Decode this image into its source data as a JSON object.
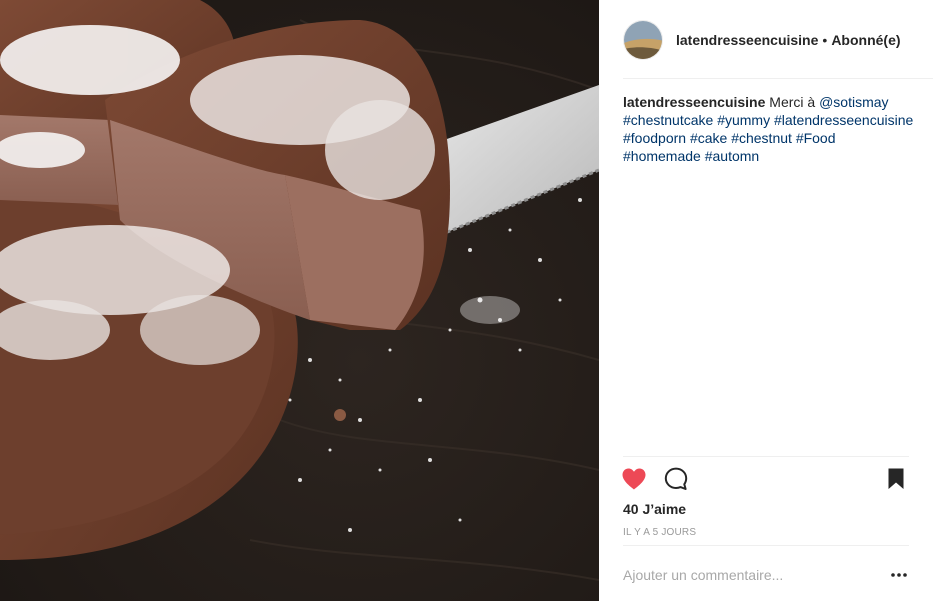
{
  "post": {
    "username": "latendresseencuisine",
    "separator": "•",
    "follow_label": "Abonné(e)",
    "caption": {
      "username": "latendresseencuisine",
      "text": "Merci à ",
      "mention": "@sotismay",
      "hashtags": [
        "#chestnutcake",
        "#yummy",
        "#latendresseencuisine",
        "#foodporn",
        "#cake",
        "#chestnut",
        "#Food",
        "#homemade",
        "#automn"
      ]
    },
    "likes_label": "40 J’aime",
    "timestamp": "IL Y A 5 JOURS",
    "comment_placeholder": "Ajouter un commentaire...",
    "icons": {
      "like": "heart-icon",
      "comment": "comment-icon",
      "save": "bookmark-icon",
      "more": "more-options-icon"
    },
    "colors": {
      "like_red": "#ed4956",
      "link_blue": "#003569",
      "text": "#262626",
      "muted": "#999999"
    }
  }
}
